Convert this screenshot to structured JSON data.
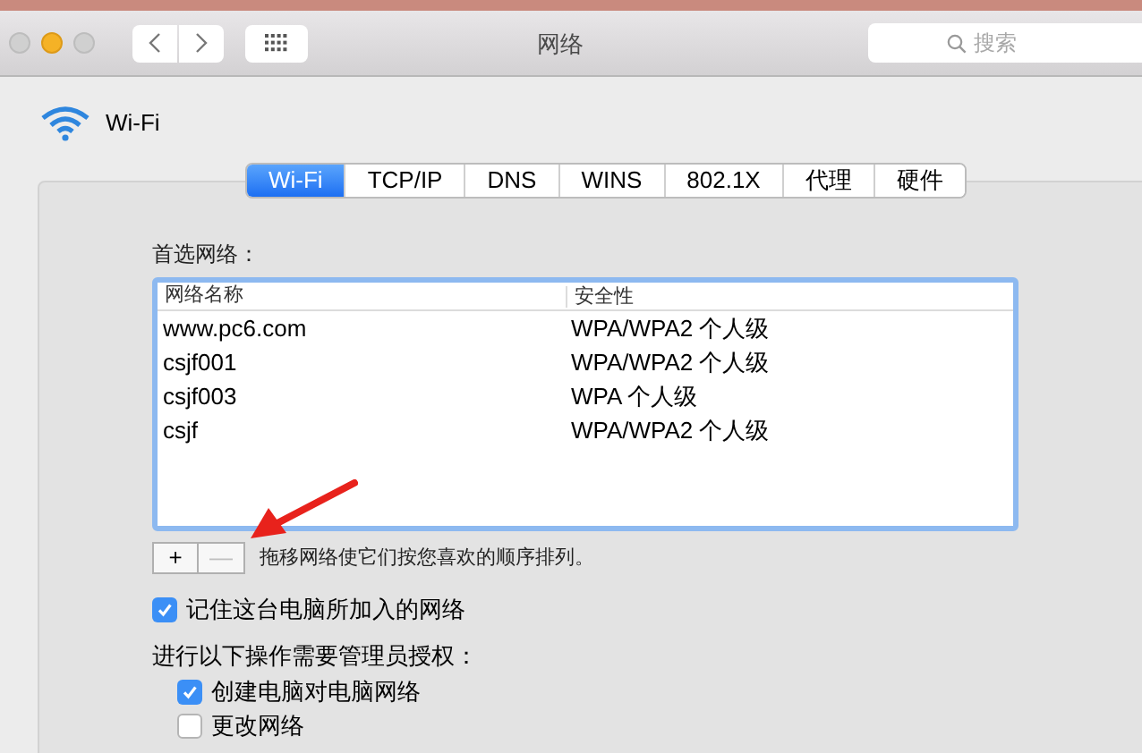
{
  "window": {
    "title": "网络"
  },
  "toolbar": {
    "search": {
      "placeholder": "搜索"
    }
  },
  "service": {
    "name": "Wi-Fi"
  },
  "tabs": [
    {
      "label": "Wi-Fi",
      "selected": true
    },
    {
      "label": "TCP/IP",
      "selected": false
    },
    {
      "label": "DNS",
      "selected": false
    },
    {
      "label": "WINS",
      "selected": false
    },
    {
      "label": "802.1X",
      "selected": false
    },
    {
      "label": "代理",
      "selected": false
    },
    {
      "label": "硬件",
      "selected": false
    }
  ],
  "preferred_networks": {
    "label": "首选网络：",
    "columns": [
      "网络名称",
      "安全性"
    ],
    "rows": [
      [
        "www.pc6.com",
        "WPA/WPA2 个人级"
      ],
      [
        "csjf001",
        "WPA/WPA2 个人级"
      ],
      [
        "csjf003",
        "WPA 个人级"
      ],
      [
        "csjf",
        "WPA/WPA2 个人级"
      ]
    ],
    "buttons": [
      {
        "label": "+",
        "disabled": false
      },
      {
        "label": "—",
        "disabled": true
      }
    ],
    "hint": "拖移网络使它们按您喜欢的顺序排列。"
  },
  "remember": {
    "label": "记住这台电脑所加入的网络",
    "checked": true
  },
  "admin": {
    "label": "进行以下操作需要管理员授权：",
    "options": [
      {
        "label": "创建电脑对电脑网络",
        "checked": true
      },
      {
        "label": "更改网络",
        "checked": false
      }
    ]
  }
}
